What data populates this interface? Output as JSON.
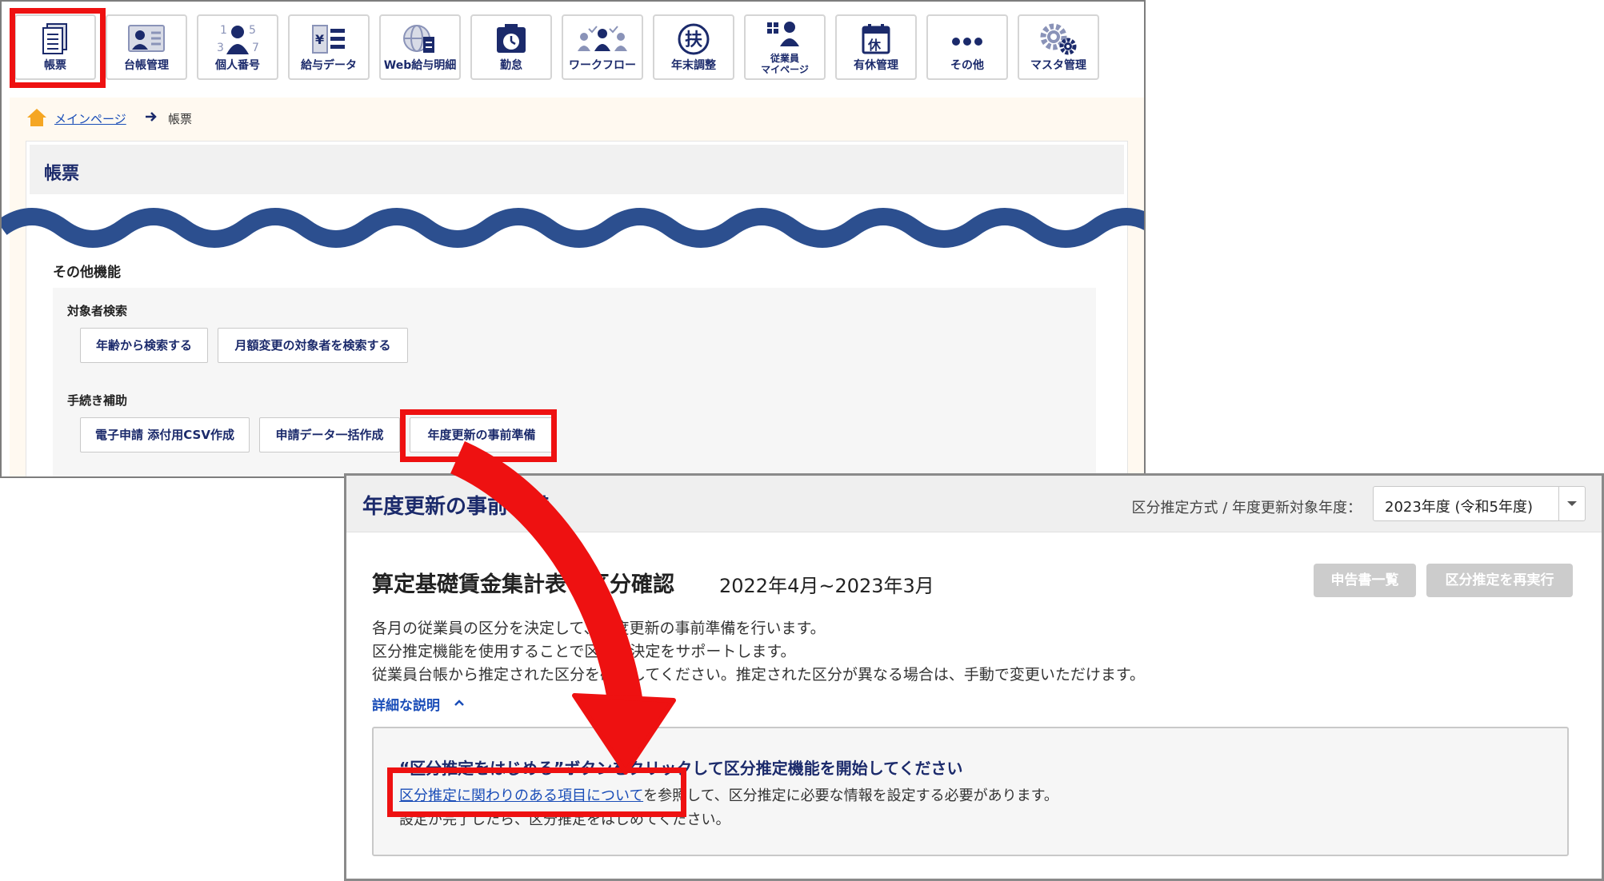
{
  "toolbar": {
    "items": [
      {
        "label": "帳票",
        "icon": "document-list-icon"
      },
      {
        "label": "台帳管理",
        "icon": "id-card-icon"
      },
      {
        "label": "個人番号",
        "icon": "person-number-icon"
      },
      {
        "label": "給与データ",
        "icon": "yen-list-icon"
      },
      {
        "label": "Web給与明細",
        "icon": "globe-document-icon"
      },
      {
        "label": "勤怠",
        "icon": "timecard-icon"
      },
      {
        "label": "ワークフロー",
        "icon": "people-flow-icon"
      },
      {
        "label": "年末調整",
        "icon": "fu-circle-icon"
      },
      {
        "label": "従業員\nマイページ",
        "icon": "employee-page-icon"
      },
      {
        "label": "有休管理",
        "icon": "holiday-calendar-icon"
      },
      {
        "label": "その他",
        "icon": "more-dots-icon"
      },
      {
        "label": "マスタ管理",
        "icon": "gears-icon"
      }
    ],
    "fu_glyph": "扶",
    "kyu_glyph": "休",
    "yen_glyph": "¥",
    "number_digits": [
      "1",
      "5",
      "3",
      "7"
    ]
  },
  "breadcrumb": {
    "home": "メインページ",
    "current": "帳票"
  },
  "card": {
    "title": "帳票"
  },
  "other_functions": {
    "title": "その他機能",
    "search": {
      "label": "対象者検索",
      "buttons": [
        "年齢から検索する",
        "月額変更の対象者を検索する"
      ]
    },
    "procedures": {
      "label": "手続き補助",
      "buttons": [
        "電子申請 添付用CSV作成",
        "申請データ一括作成",
        "年度更新の事前準備"
      ]
    }
  },
  "panel": {
    "title": "年度更新の事前準備",
    "select_label": "区分推定方式 / 年度更新対象年度：",
    "select_value": "2023年度 (令和5年度)",
    "main_title": "算定基礎賃金集計表の区分確認",
    "period": "2022年4月~2023年3月",
    "buttons": [
      "申告書一覧",
      "区分推定を再実行"
    ],
    "desc": [
      "各月の従業員の区分を決定して、年度更新の事前準備を行います。",
      "区分推定機能を使用することで区分の決定をサポートします。",
      "従業員台帳から推定された区分を確認してください。推定された区分が異なる場合は、手動で変更いただけます。"
    ],
    "detail_toggle": "詳細な説明",
    "info": {
      "heading": "“区分推定をはじめる”ボタンをクリックして区分推定機能を開始してください",
      "link": "区分推定に関わりのある項目について",
      "line1_rest": "を参照して、区分推定に必要な情報を設定する必要があります。",
      "line2": "設定が完了したら、区分推定をはじめてください。"
    }
  },
  "colors": {
    "accent_red": "#ee1111",
    "navy": "#1b2a6b",
    "wave_blue": "#2c4f8f",
    "link_blue": "#1a4db8"
  }
}
